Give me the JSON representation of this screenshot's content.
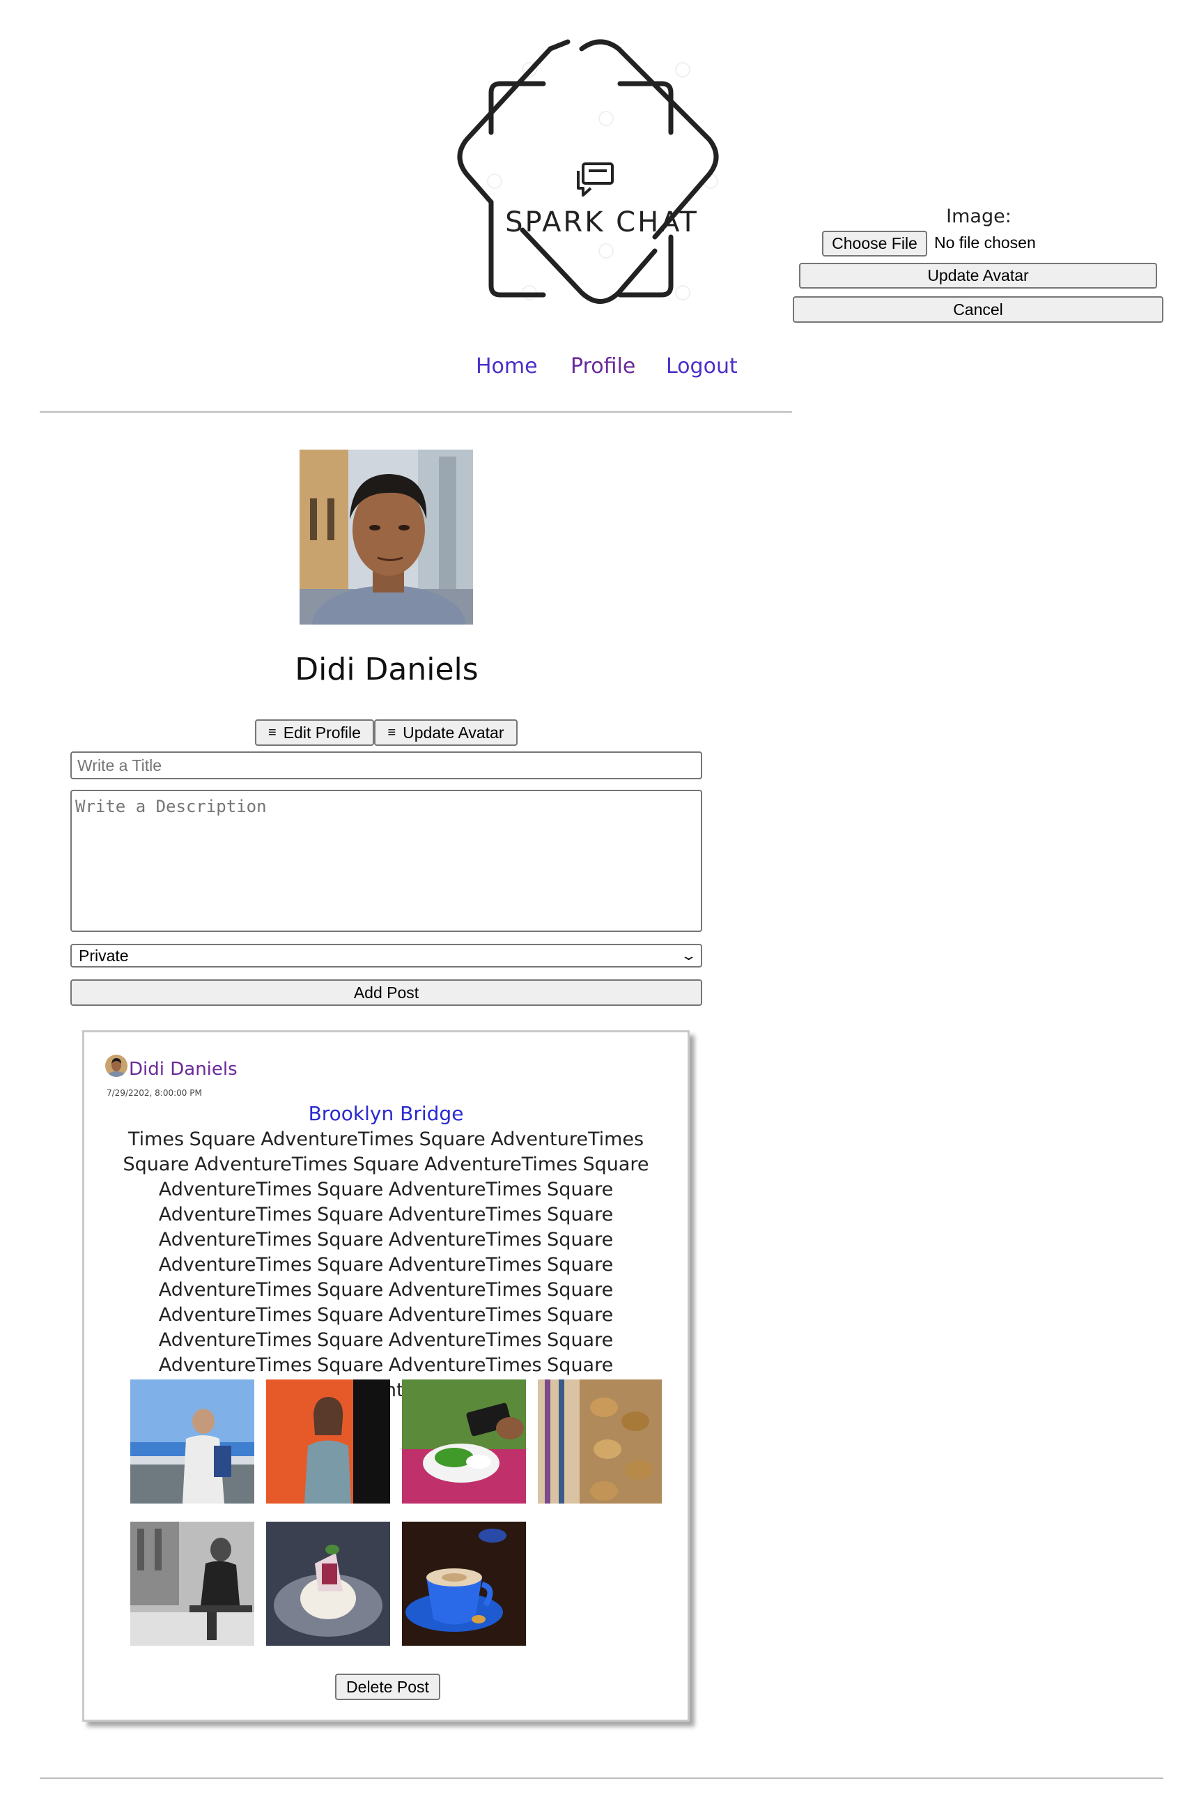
{
  "brand": {
    "logo_text": "SPARK CHAT"
  },
  "nav": {
    "home": "Home",
    "profile": "Profile",
    "logout": "Logout"
  },
  "avatar_form": {
    "image_label": "Image:",
    "choose_file": "Choose File",
    "file_status": "No file chosen",
    "update_avatar": "Update Avatar",
    "cancel": "Cancel"
  },
  "profile": {
    "name": "Didi Daniels",
    "edit_profile": "Edit Profile",
    "update_avatar": "Update Avatar",
    "menu_glyph": "≡"
  },
  "new_post": {
    "title_placeholder": "Write a Title",
    "description_placeholder": "Write a Description",
    "visibility_selected": "Private",
    "add_post": "Add Post"
  },
  "post": {
    "author": "Didi Daniels",
    "date": "7/29/2202, 8:00:00 PM",
    "title": "Brooklyn Bridge",
    "body": "Times Square AdventureTimes Square AdventureTimes Square AdventureTimes Square AdventureTimes Square AdventureTimes Square AdventureTimes Square AdventureTimes Square AdventureTimes Square AdventureTimes Square AdventureTimes Square AdventureTimes Square AdventureTimes Square AdventureTimes Square AdventureTimes Square AdventureTimes Square AdventureTimes Square AdventureTimes Square AdventureTimes Square AdventureTimes Square AdventureTimes Square Adventure",
    "delete": "Delete Post",
    "images": [
      "man-at-waterfront",
      "woman-orange-backdrop",
      "salad-and-phone",
      "cookies-and-fabric",
      "man-on-bench-bw",
      "plated-dessert",
      "blue-coffee-cup"
    ]
  },
  "colors": {
    "link": "#4b2ec9",
    "visited_link": "#6a2a9a",
    "post_title": "#2a2ad1"
  }
}
